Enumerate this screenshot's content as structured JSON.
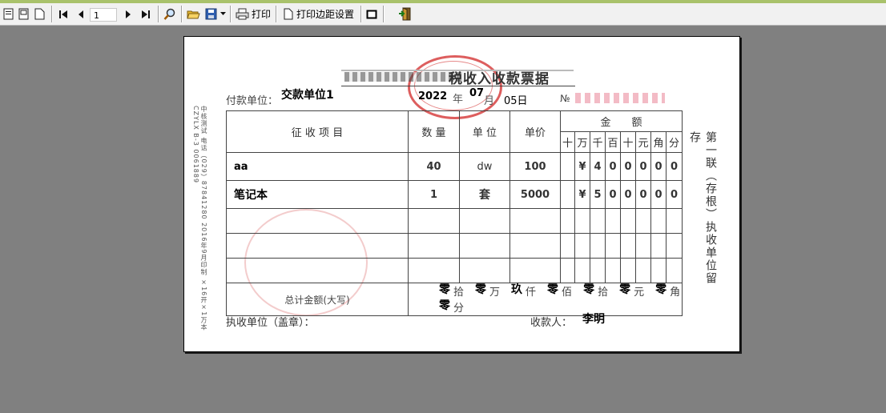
{
  "toolbar": {
    "print_label": "打印",
    "margin_label": "打印边距设置",
    "page_number": "1"
  },
  "receipt": {
    "title_fragment": "税收入收款票据",
    "payer_label": "付款单位：",
    "payer_value": "交款单位1",
    "year": "2022",
    "year_char": "年",
    "month": "07",
    "month_char": "月",
    "day": "05日",
    "no_label": "№",
    "col_item": "征 收 项 目",
    "col_qty": "数 量",
    "col_unit": "单 位",
    "col_price": "单价",
    "col_amount": "金　　额",
    "digit_headers": [
      "十",
      "万",
      "千",
      "百",
      "十",
      "元",
      "角",
      "分"
    ],
    "rows": [
      {
        "item": "aa",
        "qty": "40",
        "unit": "dw",
        "price": "100",
        "currency": "¥",
        "digits": [
          "4",
          "0",
          "0",
          "0",
          "0",
          "0"
        ]
      },
      {
        "item": "笔记本",
        "qty": "1",
        "unit": "套",
        "price": "5000",
        "currency": "¥",
        "digits": [
          "5",
          "0",
          "0",
          "0",
          "0",
          "0"
        ]
      }
    ],
    "total_label": "总计金额(大写)",
    "total_parts": [
      {
        "value": "零",
        "unit": "拾"
      },
      {
        "value": "零",
        "unit": "万"
      },
      {
        "value": "玖",
        "unit": "仟"
      },
      {
        "value": "零",
        "unit": "佰"
      },
      {
        "value": "零",
        "unit": "拾"
      },
      {
        "value": "零",
        "unit": "元"
      },
      {
        "value": "零",
        "unit": "角"
      },
      {
        "value": "零",
        "unit": "分"
      }
    ],
    "side_note": "第一联（存根）执收单位留存",
    "left_vertical": "中核测试 电话（029）87841280 2016年9月印制 ×16开×1万本 CZYLX B-3 0061889",
    "collector_unit_label": "执收单位（盖章）：",
    "payee_label": "收款人：",
    "payee_value": "李明"
  }
}
